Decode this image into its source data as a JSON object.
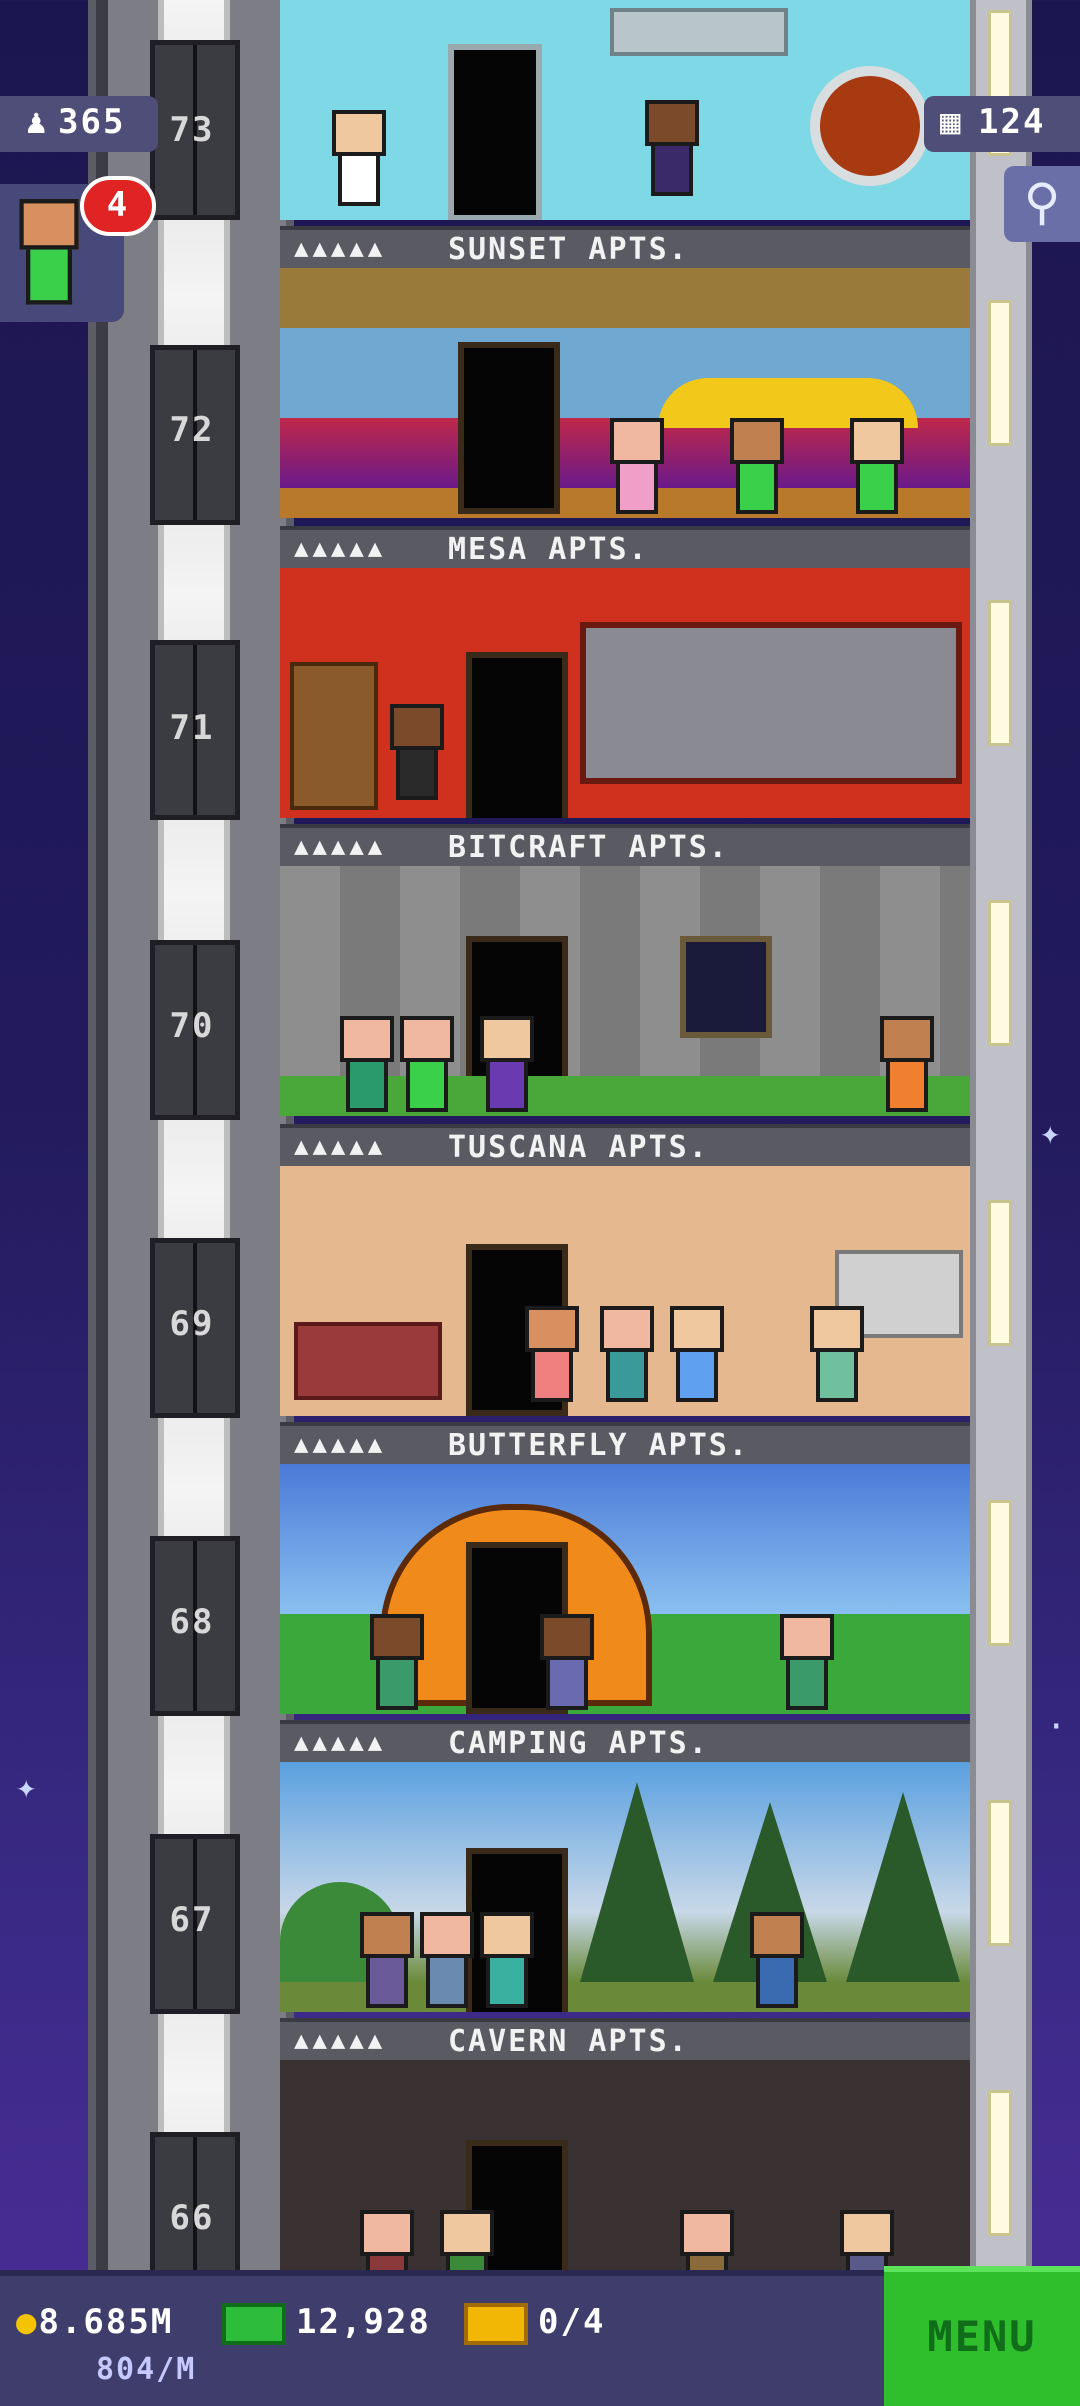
{
  "hud": {
    "population": "365",
    "visitor_count": "4",
    "floors_count": "124",
    "coins": "8.685M",
    "bux": "12,928",
    "tickets": "0/4",
    "coin_rate": "804/M",
    "menu_label": "MENU"
  },
  "icons": {
    "population": "person-icon",
    "floors": "building-icon",
    "search": "magnifier-icon",
    "coins": "coin-icon",
    "bux": "bux-icon",
    "tickets": "ticket-icon"
  },
  "floors": [
    {
      "number": "73",
      "name": ""
    },
    {
      "number": "72",
      "name": "SUNSET APTS."
    },
    {
      "number": "71",
      "name": "MESA APTS."
    },
    {
      "number": "70",
      "name": "BITCRAFT APTS."
    },
    {
      "number": "69",
      "name": "TUSCANA APTS."
    },
    {
      "number": "68",
      "name": "BUTTERFLY APTS."
    },
    {
      "number": "67",
      "name": "CAMPING APTS."
    },
    {
      "number": "66",
      "name": "CAVERN APTS."
    }
  ],
  "colors": {
    "sky": "#1c1650",
    "menu": "#2fbf2c",
    "badge": "#e02424"
  }
}
